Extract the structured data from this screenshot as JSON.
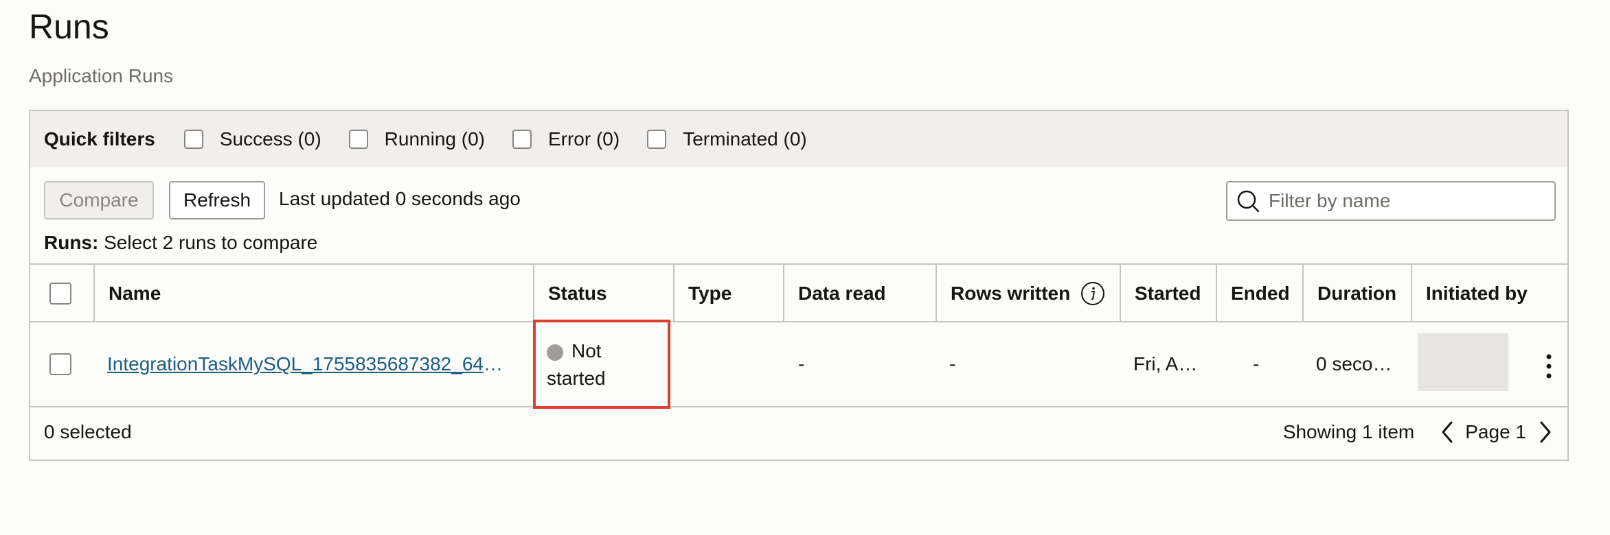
{
  "page": {
    "title": "Runs",
    "subtitle": "Application Runs"
  },
  "quick_filters": {
    "label": "Quick filters",
    "items": [
      {
        "label": "Success (0)"
      },
      {
        "label": "Running (0)"
      },
      {
        "label": "Error (0)"
      },
      {
        "label": "Terminated (0)"
      }
    ]
  },
  "toolbar": {
    "compare_label": "Compare",
    "refresh_label": "Refresh",
    "last_updated": "Last updated 0 seconds ago",
    "search_placeholder": "Filter by name"
  },
  "runs_hint": {
    "prefix": "Runs:",
    "text": "Select 2 runs to compare"
  },
  "table": {
    "columns": [
      "Name",
      "Status",
      "Type",
      "Data read",
      "Rows written",
      "Started",
      "Ended",
      "Duration",
      "Initiated by"
    ],
    "rows": [
      {
        "name": "IntegrationTaskMySQL_1755835687382_647…",
        "status": "Not started",
        "type": "",
        "data_read": "-",
        "rows_written": "-",
        "started": "Fri, A…",
        "ended": "-",
        "duration": "0 seco…"
      }
    ]
  },
  "footer": {
    "selected": "0 selected",
    "showing": "Showing 1 item",
    "page": "Page 1"
  },
  "colors": {
    "link": "#1e5d82",
    "highlight": "#e0402b",
    "status_dot": "#a09d98"
  },
  "icons": [
    "search-icon",
    "info-icon",
    "chevron-left-icon",
    "chevron-right-icon",
    "more-vertical-icon"
  ]
}
